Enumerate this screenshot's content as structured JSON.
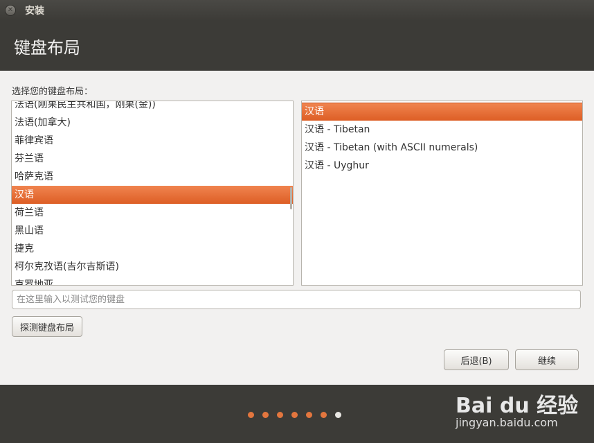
{
  "window": {
    "title": "安装"
  },
  "header": {
    "title": "键盘布局"
  },
  "prompt": "选择您的键盘布局：",
  "layouts": [
    "法语(刚果民主共和国，刚果(金))",
    "法语(加拿大)",
    "菲律宾语",
    "芬兰语",
    "哈萨克语",
    "汉语",
    "荷兰语",
    "黑山语",
    "捷克",
    "柯尔克孜语(吉尔吉斯语)",
    "克罗地亚"
  ],
  "layouts_selected": 5,
  "variants": [
    "汉语",
    "汉语 - Tibetan",
    "汉语 - Tibetan (with ASCII numerals)",
    "汉语 - Uyghur"
  ],
  "variants_selected": 0,
  "test_input": {
    "placeholder": "在这里输入以测试您的键盘",
    "value": ""
  },
  "buttons": {
    "detect": "探测键盘布局",
    "back": "后退(B)",
    "continue": "继续"
  },
  "progress": {
    "total_steps": 7,
    "current_step": 7
  },
  "watermark": {
    "brand": "Bai du 经验",
    "url": "jingyan.baidu.com"
  },
  "colors": {
    "accent": "#dd5e25",
    "chrome": "#3c3b37",
    "background": "#f2f1f0"
  }
}
